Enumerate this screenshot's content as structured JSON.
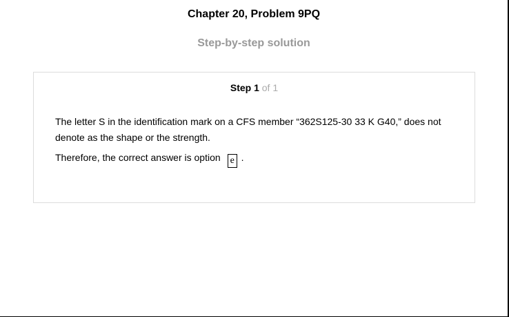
{
  "header": {
    "title": "Chapter 20, Problem 9PQ",
    "subtitle": "Step-by-step solution"
  },
  "step": {
    "label": "Step 1",
    "of_text": "of 1",
    "paragraph": "The letter S in the identification mark on a CFS member “362S125-30 33 K G40,” does not denote as the shape or the strength.",
    "answer_prefix": "Therefore, the correct answer is option",
    "answer_option": "e",
    "answer_suffix": "."
  }
}
